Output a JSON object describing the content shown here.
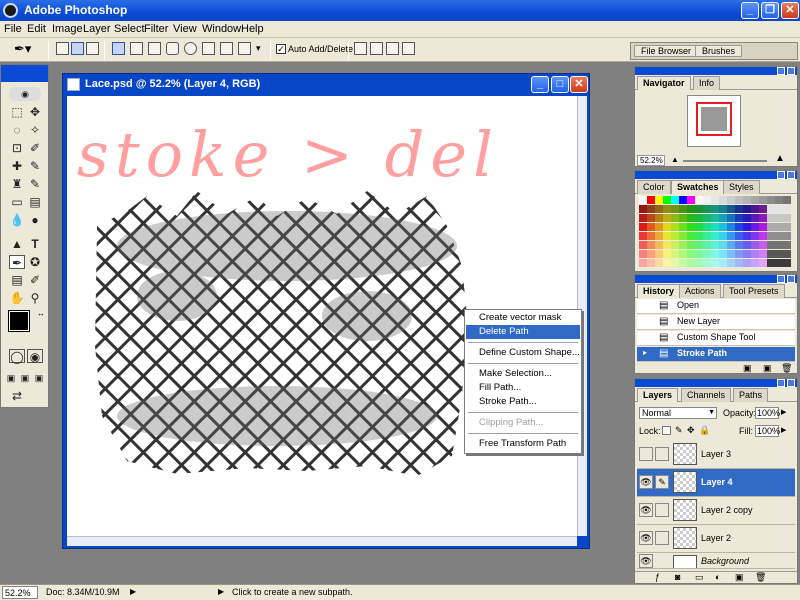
{
  "app": {
    "title": "Adobe Photoshop"
  },
  "menu": [
    "File",
    "Edit",
    "Image",
    "Layer",
    "Select",
    "Filter",
    "View",
    "Window",
    "Help"
  ],
  "options": {
    "auto_add_delete": "Auto Add/Delete"
  },
  "wells": {
    "file_browser": "File Browser",
    "brushes": "Brushes"
  },
  "document": {
    "title": "Lace.psd @ 52.2% (Layer 4, RGB)",
    "annotation": "stoke > del"
  },
  "context_menu": {
    "items": [
      "Create vector mask",
      "Delete Path",
      "Define Custom Shape...",
      "Make Selection...",
      "Fill Path...",
      "Stroke Path...",
      "Clipping Path...",
      "Free Transform Path"
    ],
    "highlighted": "Delete Path",
    "disabled": "Clipping Path..."
  },
  "navigator": {
    "tabs": [
      "Navigator",
      "Info"
    ],
    "zoom": "52.2%"
  },
  "swatches": {
    "tabs": [
      "Color",
      "Swatches",
      "Styles"
    ],
    "colors": [
      "#ffffff",
      "#ff0000",
      "#ffff00",
      "#00ff00",
      "#00ffff",
      "#0000ff",
      "#ff00ff",
      "#ffffff",
      "#f2f2f2",
      "#e6e6e6",
      "#d9d9d9",
      "#cccccc",
      "#bfbfbf",
      "#b3b3b3",
      "#a6a6a6",
      "#999999",
      "#8c8c8c",
      "#808080",
      "#737373",
      "#000000"
    ]
  },
  "history": {
    "tabs": [
      "History",
      "Actions",
      "Tool Presets"
    ],
    "items": [
      "Open",
      "New Layer",
      "Custom Shape Tool",
      "Stroke Path"
    ],
    "current": "Stroke Path"
  },
  "layers": {
    "tabs": [
      "Layers",
      "Channels",
      "Paths"
    ],
    "blend_mode": "Normal",
    "opacity_label": "Opacity:",
    "opacity": "100%",
    "lock_label": "Lock:",
    "fill_label": "Fill:",
    "fill": "100%",
    "items": [
      "Layer 3",
      "Layer 4",
      "Layer 2 copy",
      "Layer 2",
      "Background"
    ],
    "selected": "Layer 4"
  },
  "status": {
    "zoom": "52.2%",
    "doc": "Doc: 8.34M/10.9M",
    "hint": "Click to create a new subpath."
  }
}
